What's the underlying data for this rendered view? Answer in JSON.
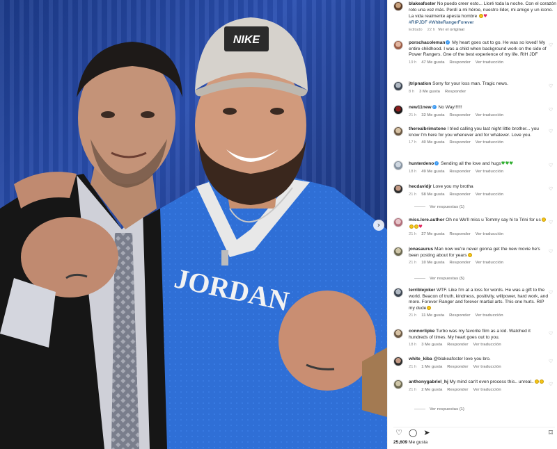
{
  "post": {
    "username": "blakeafoster",
    "caption": "No puedo creer esto... Lloré toda la noche. Con el corazón roto una vez más. Perdí a mi héroe, nuestro líder, mi amigo y un icono. La vida realmente apesta hombre",
    "hashtags": "#RIPJDF #WhiteRangerForever",
    "edited_label": "Editado",
    "age": "22 h",
    "see_original": "Ver el original",
    "likes_count": "25,609",
    "likes_label": "Me gusta"
  },
  "photo": {
    "cap_brand": "NIKE",
    "jersey_text": "JORDAN"
  },
  "labels": {
    "reply": "Responder",
    "see_translation": "Ver traducción",
    "view_replies_prefix": "Ver respuestas"
  },
  "comments": [
    {
      "username": "porschacoleman",
      "verified": true,
      "text": "My heart goes out to go. He was so loved! My entire childhood. I was a child when background work on the side of Power Rangers. One of the best experience of my life. RIH JDF",
      "age": "19 h",
      "likes": "47 Me gusta",
      "translate": true
    },
    {
      "username": "jtripnation",
      "verified": false,
      "text": "Sorry for your loss man. Tragic news.",
      "age": "8 h",
      "likes": "3 Me gusta",
      "translate": false
    },
    {
      "username": "new11new",
      "verified": true,
      "text": "No Way!!!!!!",
      "age": "21 h",
      "likes": "32 Me gusta",
      "translate": true
    },
    {
      "username": "therealbrimstone",
      "verified": false,
      "text": "I tried calling you last night little brother... you know I'm here for you whenever and for whatever. Love you.",
      "age": "17 h",
      "likes": "40 Me gusta",
      "translate": true
    },
    {
      "username": "hunterdeno",
      "verified": true,
      "text": "Sending all the love and hugs",
      "age": "18 h",
      "likes": "49 Me gusta",
      "translate": true
    },
    {
      "username": "hecdavidjr",
      "verified": false,
      "text": "Love you my brotha",
      "age": "21 h",
      "likes": "58 Me gusta",
      "translate": true,
      "replies": "(1)"
    },
    {
      "username": "miss.lore.author",
      "verified": false,
      "text": "Oh no We'll miss u Tommy say hi to Trini for us",
      "age": "21 h",
      "likes": "27 Me gusta",
      "translate": true
    },
    {
      "username": "jonasaurus",
      "verified": false,
      "text": "Man now we're never gonna get the new movie he's been posting about for years",
      "age": "21 h",
      "likes": "10 Me gusta",
      "translate": true,
      "replies": "(5)"
    },
    {
      "username": "terriblejoker",
      "verified": false,
      "text": "WTF. Like I'm at a loss for words. He was a gift to the world. Beacon of truth, kindness, positivity, willpower, hard work, and more. Forever Ranger and forever martial arts. This one hurts. RIP my dude",
      "age": "21 h",
      "likes": "11 Me gusta",
      "translate": true
    },
    {
      "username": "connorlipke",
      "verified": false,
      "text": "Turbo was my favorite film as a kid. Watched it hundreds of times. My heart goes out to you.",
      "age": "18 h",
      "likes": "3 Me gusta",
      "translate": true
    },
    {
      "username": "white_kiba",
      "verified": false,
      "text": "@blakeafoster love you bro.",
      "age": "21 h",
      "likes": "1 Me gusta",
      "translate": true
    },
    {
      "username": "anthonygabriel_hj",
      "verified": false,
      "text": "My mind can't even process this.. unreal..",
      "age": "21 h",
      "likes": "2 Me gusta",
      "translate": true,
      "replies": "(1)"
    }
  ]
}
